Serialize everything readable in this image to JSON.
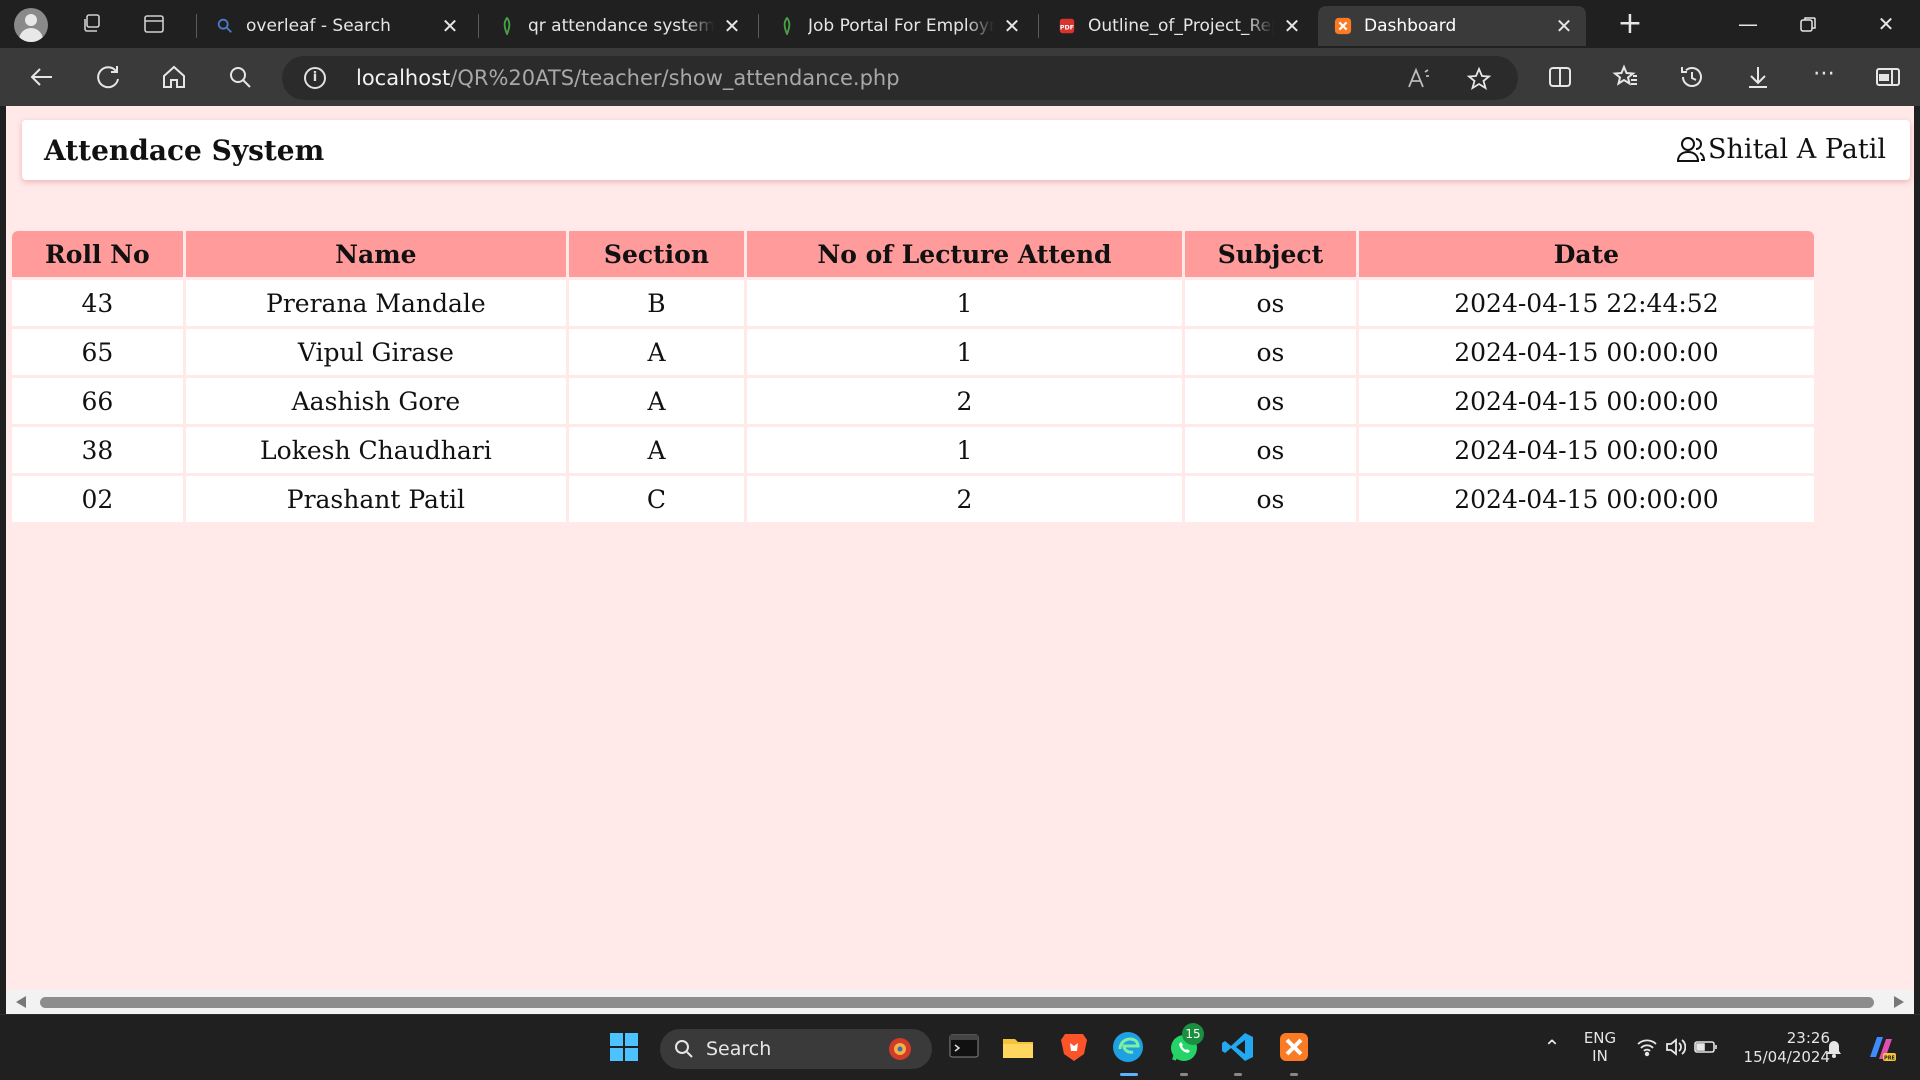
{
  "browser": {
    "tabs": [
      {
        "label": "overleaf - Search",
        "favicon": "search-icon",
        "active": false
      },
      {
        "label": "qr attendance system -",
        "favicon": "mongodb-leaf-icon",
        "active": false
      },
      {
        "label": "Job Portal For Employm",
        "favicon": "mongodb-leaf-icon",
        "active": false
      },
      {
        "label": "Outline_of_Project_Rep",
        "favicon": "pdf-icon",
        "active": false
      },
      {
        "label": "Dashboard",
        "favicon": "xampp-icon",
        "active": true
      }
    ],
    "address": {
      "host": "localhost",
      "path": "/QR%20ATS/teacher/show_attendance.php"
    }
  },
  "navbar": {
    "brand": "Attendace System",
    "user_name": "Shital A Patil"
  },
  "attendance": {
    "headers": {
      "roll_no": "Roll No",
      "name": "Name",
      "section": "Section",
      "lectures": "No of Lecture Attend",
      "subject": "Subject",
      "date": "Date"
    },
    "rows": [
      {
        "roll_no": "43",
        "name": "Prerana Mandale",
        "section": "B",
        "lectures": "1",
        "subject": "os",
        "date": "2024-04-15 22:44:52"
      },
      {
        "roll_no": "65",
        "name": "Vipul Girase",
        "section": "A",
        "lectures": "1",
        "subject": "os",
        "date": "2024-04-15 00:00:00"
      },
      {
        "roll_no": "66",
        "name": "Aashish Gore",
        "section": "A",
        "lectures": "2",
        "subject": "os",
        "date": "2024-04-15 00:00:00"
      },
      {
        "roll_no": "38",
        "name": "Lokesh Chaudhari",
        "section": "A",
        "lectures": "1",
        "subject": "os",
        "date": "2024-04-15 00:00:00"
      },
      {
        "roll_no": "02",
        "name": "Prashant Patil",
        "section": "C",
        "lectures": "2",
        "subject": "os",
        "date": "2024-04-15 00:00:00"
      }
    ]
  },
  "taskbar": {
    "search_label": "Search",
    "whatsapp_badge": "15",
    "language": "ENG",
    "region": "IN",
    "time": "23:26",
    "date": "15/04/2024"
  },
  "colors": {
    "page_bg": "#ffe9e9",
    "header_bg": "#ff9b9b",
    "chrome_dark": "#202020",
    "chrome_toolbar": "#3a3a3a"
  }
}
